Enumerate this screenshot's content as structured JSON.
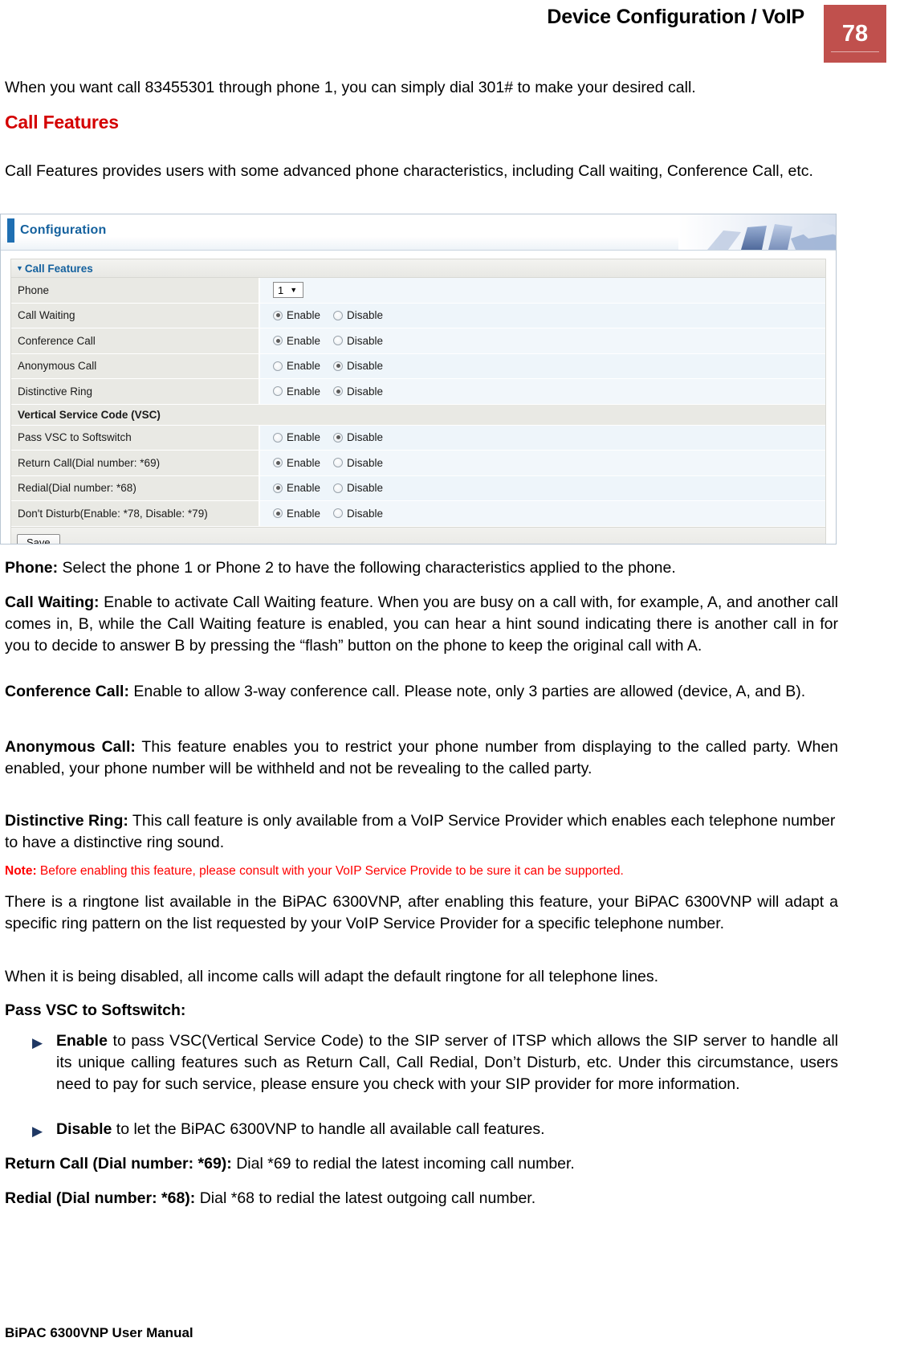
{
  "header": {
    "title": "Device Configuration / VoIP",
    "page_number": "78"
  },
  "intro_paragraph": "When you want call 83455301 through phone 1, you can simply dial 301# to make your desired call.",
  "section_heading": "Call Features",
  "section_intro": "Call Features provides users with some advanced phone characteristics, including Call waiting, Conference Call, etc.",
  "config_panel": {
    "title": "Configuration",
    "section_label": "Call Features",
    "phone_label": "Phone",
    "phone_value": "1",
    "rows": [
      {
        "label": "Call Waiting",
        "enable_label": "Enable",
        "disable_label": "Disable",
        "selected": "Enable"
      },
      {
        "label": "Conference Call",
        "enable_label": "Enable",
        "disable_label": "Disable",
        "selected": "Enable"
      },
      {
        "label": "Anonymous Call",
        "enable_label": "Enable",
        "disable_label": "Disable",
        "selected": "Disable"
      },
      {
        "label": "Distinctive Ring",
        "enable_label": "Enable",
        "disable_label": "Disable",
        "selected": "Disable"
      }
    ],
    "vsc_subheading": "Vertical Service Code (VSC)",
    "vsc_rows": [
      {
        "label": "Pass VSC to Softswitch",
        "enable_label": "Enable",
        "disable_label": "Disable",
        "selected": "Disable"
      },
      {
        "label": "Return Call(Dial number: *69)",
        "enable_label": "Enable",
        "disable_label": "Disable",
        "selected": "Enable"
      },
      {
        "label": "Redial(Dial number: *68)",
        "enable_label": "Enable",
        "disable_label": "Disable",
        "selected": "Enable"
      },
      {
        "label": "Don't Disturb(Enable: *78, Disable: *79)",
        "enable_label": "Enable",
        "disable_label": "Disable",
        "selected": "Enable"
      }
    ],
    "save_label": "Save"
  },
  "descriptions": {
    "phone_term": "Phone:",
    "phone_text": " Select the phone 1 or Phone 2 to have the following characteristics applied to the phone.",
    "call_waiting_term": "Call Waiting:",
    "call_waiting_text": " Enable to activate Call Waiting feature. When you are busy on a call with, for example, A, and another call comes in, B, while the Call Waiting feature is enabled, you can hear a hint sound indicating there is another call in for you to decide to answer B by pressing the “flash” button on the phone to keep the original call with A.",
    "conference_call_term": "Conference Call:",
    "conference_call_text": " Enable to allow 3-way conference call. Please note, only 3 parties are allowed (device, A, and B).",
    "anonymous_call_term": "Anonymous Call:",
    "anonymous_call_text": " This feature enables you to restrict your phone number from displaying to the called party. When enabled, your phone number will be withheld and not be revealing to the called party.",
    "distinctive_ring_term": "Distinctive Ring:",
    "distinctive_ring_text": " This call feature is only available from a VoIP Service Provider which enables each telephone number to have a distinctive ring sound.",
    "note_term": "Note:",
    "note_text": " Before enabling this feature, please consult with your VoIP Service Provide to be sure it can be supported.",
    "ringtone_paragraph": "There is a ringtone list available in the BiPAC 6300VNP, after enabling this feature, your BiPAC 6300VNP will adapt a specific ring pattern on the list requested by your VoIP Service Provider for a specific telephone number.",
    "disabled_paragraph": "When it is being disabled, all income calls will adapt the default ringtone for all telephone lines.",
    "pass_vsc_term": "Pass VSC to Softswitch:",
    "bullet_enable_term": "Enable",
    "bullet_enable_text": " to pass VSC(Vertical Service Code) to the SIP server of ITSP which allows the SIP server to handle all its unique calling features  such as Return Call, Call Redial, Don’t Disturb, etc. Under this circumstance, users need to pay for such service, please ensure you check with your SIP provider for more information.",
    "bullet_disable_term": "Disable",
    "bullet_disable_text": " to let the BiPAC 6300VNP to handle all available call features.",
    "return_call_term": "Return Call (Dial number: *69):",
    "return_call_text": " Dial *69 to redial the latest incoming call number.",
    "redial_term": "Redial (Dial number: *68):",
    "redial_text": " Dial *68 to redial the latest outgoing call number."
  },
  "footer": "BiPAC 6300VNP User Manual",
  "colors": {
    "page_number_bg": "#c0504d",
    "heading_red": "#d40000",
    "note_red": "#ff0000",
    "panel_blue": "#14619e"
  }
}
